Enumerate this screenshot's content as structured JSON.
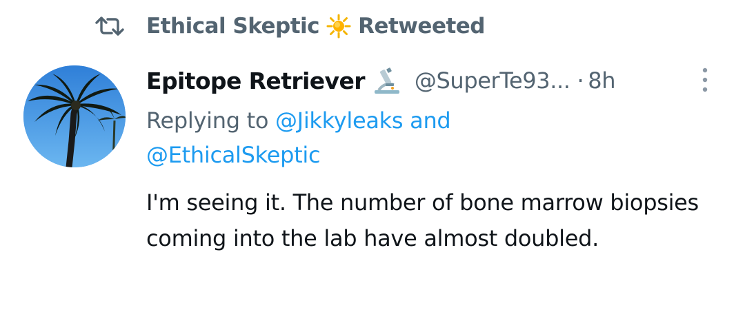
{
  "retweet": {
    "retweeter_name": "Ethical Skeptic",
    "retweeter_emoji": "sun-emoji",
    "label": "Retweeted",
    "icon": "retweet-icon"
  },
  "tweet": {
    "avatar": "palm-tree-avatar",
    "display_name": "Epitope Retriever",
    "name_emoji": "microscope-emoji",
    "handle": "@SuperTe93...",
    "separator": "·",
    "timestamp": "8h",
    "reply_prefix": "Replying to",
    "reply_mention_1": "@Jikkyleaks",
    "reply_and": "and",
    "reply_mention_2": "@EthicalSkeptic",
    "text": "I'm seeing it. The number of bone marrow biopsies coming into the lab have almost doubled."
  },
  "colors": {
    "secondary_text": "#536471",
    "link": "#1d9bf0",
    "primary_text": "#0f1419"
  }
}
